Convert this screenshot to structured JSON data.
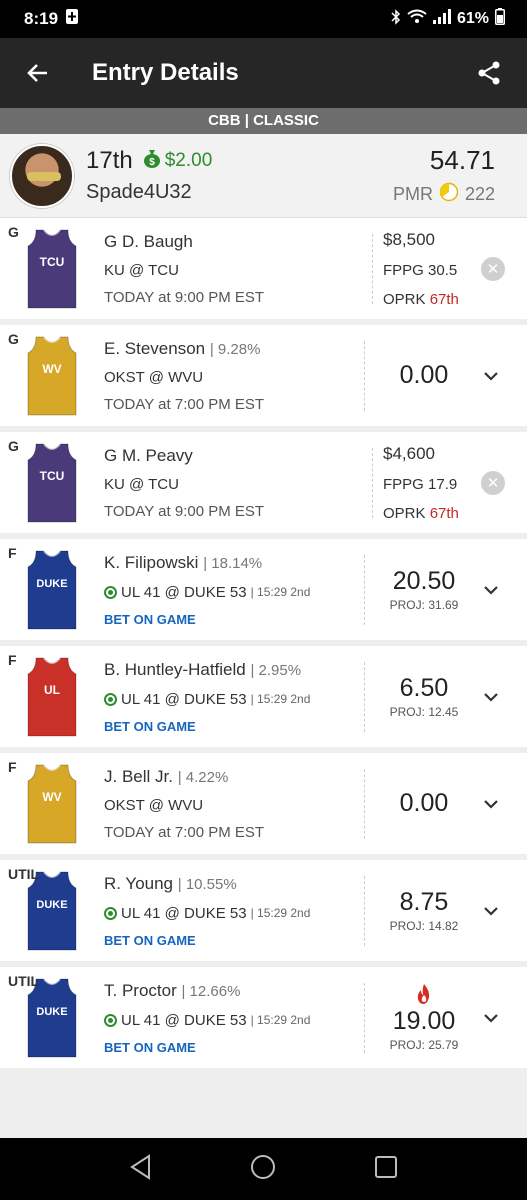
{
  "status": {
    "time": "8:19",
    "battery": "61%"
  },
  "header": {
    "title": "Entry Details"
  },
  "contest": {
    "label": "CBB | CLASSIC"
  },
  "entry": {
    "rank": "17th",
    "winnings": "$2.00",
    "username": "Spade4U32",
    "score": "54.71",
    "pmr_label": "PMR",
    "pmr_value": "222"
  },
  "players": [
    {
      "pos": "G",
      "name": "G D. Baugh",
      "own": "",
      "jersey_text": "TCU",
      "jersey_color": "#4b3a7a",
      "game": "KU @ TCU",
      "time": "TODAY at 9:00 PM EST",
      "salary": "$8,500",
      "fppg_label": "FPPG",
      "fppg": "30.5",
      "oprk_label": "OPRK",
      "oprk": "67th"
    },
    {
      "pos": "G",
      "name": "E. Stevenson",
      "own": "| 9.28%",
      "jersey_text": "WV",
      "jersey_color": "#d7a727",
      "game": "OKST @ WVU",
      "time": "TODAY at 7:00 PM EST",
      "points": "0.00"
    },
    {
      "pos": "G",
      "name": "G M. Peavy",
      "own": "",
      "jersey_text": "TCU",
      "jersey_color": "#4b3a7a",
      "game": "KU @ TCU",
      "time": "TODAY at 9:00 PM EST",
      "salary": "$4,600",
      "fppg_label": "FPPG",
      "fppg": "17.9",
      "oprk_label": "OPRK",
      "oprk": "67th"
    },
    {
      "pos": "F",
      "name": "K. Filipowski",
      "own": "| 18.14%",
      "jersey_text": "DUKE",
      "jersey_color": "#1f3c8f",
      "game": "UL 41 @ DUKE 53",
      "clock": "| 15:29 2nd",
      "bet": "BET ON GAME",
      "points": "20.50",
      "proj": "PROJ: 31.69"
    },
    {
      "pos": "F",
      "name": "B. Huntley-Hatfield",
      "own": "| 2.95%",
      "jersey_text": "UL",
      "jersey_color": "#c93128",
      "game": "UL 41 @ DUKE 53",
      "clock": "| 15:29 2nd",
      "bet": "BET ON GAME",
      "points": "6.50",
      "proj": "PROJ: 12.45"
    },
    {
      "pos": "F",
      "name": "J. Bell Jr.",
      "own": "| 4.22%",
      "jersey_text": "WV",
      "jersey_color": "#d7a727",
      "game": "OKST @ WVU",
      "time": "TODAY at 7:00 PM EST",
      "points": "0.00"
    },
    {
      "pos": "UTIL",
      "name": "R. Young",
      "own": "| 10.55%",
      "jersey_text": "DUKE",
      "jersey_color": "#1f3c8f",
      "game": "UL 41 @ DUKE 53",
      "clock": "| 15:29 2nd",
      "bet": "BET ON GAME",
      "points": "8.75",
      "proj": "PROJ: 14.82"
    },
    {
      "pos": "UTIL",
      "name": "T. Proctor",
      "own": "| 12.66%",
      "jersey_text": "DUKE",
      "jersey_color": "#1f3c8f",
      "game": "UL 41 @ DUKE 53",
      "clock": "| 15:29 2nd",
      "bet": "BET ON GAME",
      "points": "19.00",
      "proj": "PROJ: 25.79"
    }
  ]
}
